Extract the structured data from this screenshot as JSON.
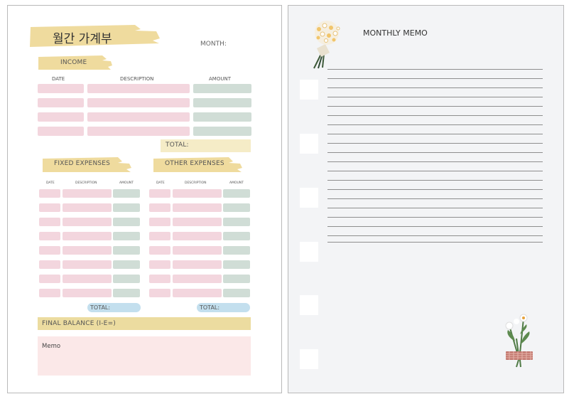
{
  "title": "월간 가계부",
  "month_label": "MONTH:",
  "income": {
    "label": "INCOME",
    "headers": [
      "DATE",
      "DESCRIPTION",
      "AMOUNT"
    ],
    "total_label": "TOTAL:"
  },
  "fixed_expenses": {
    "label": "FIXED EXPENSES",
    "headers": [
      "DATE",
      "DESCRIPTION",
      "AMOUNT"
    ],
    "total_label": "TOTAL:"
  },
  "other_expenses": {
    "label": "OTHER EXPENSES",
    "headers": [
      "DATE",
      "DESCRIPTION",
      "AMOUNT"
    ],
    "total_label": "TOTAL:"
  },
  "final_balance_label": "FINAL BALANCE (I-E=)",
  "memo_label": "Memo",
  "monthly_memo_title": "MONTHLY MEMO",
  "colors": {
    "yellow": "#efdb9e",
    "pink": "#f3d6de",
    "green": "#d0ddd6",
    "blue": "#c3dfee",
    "memo_pink": "#fbe8e8"
  },
  "icons": [
    "flower-bouquet-icon",
    "daisy-bouquet-icon"
  ]
}
